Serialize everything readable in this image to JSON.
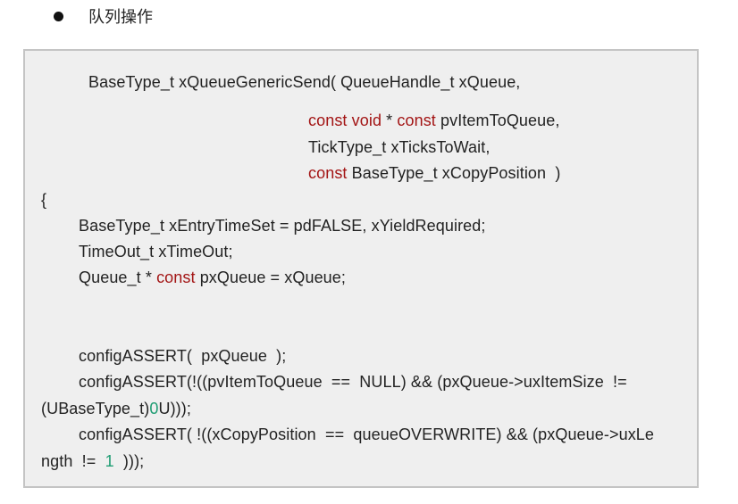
{
  "heading": {
    "text": "队列操作"
  },
  "code": {
    "colors": {
      "keyword": "#a31515",
      "number": "#1f9d73",
      "text": "#222222"
    },
    "l1": {
      "a": "BaseType_t xQueueGenericSend( QueueHandle_t xQueue,"
    },
    "l2": {
      "k1": "const",
      "k2": "void",
      "t1": " * ",
      "k3": "const",
      "t2": " pvItemToQueue,"
    },
    "l3": {
      "a": "TickType_t xTicksToWait,"
    },
    "l4": {
      "k1": "const",
      "t1": " BaseType_t xCopyPosition  )"
    },
    "l5": {
      "a": "{"
    },
    "l6": {
      "a": "BaseType_t xEntryTimeSet = pdFALSE, xYieldRequired;"
    },
    "l7": {
      "a": "TimeOut_t xTimeOut;"
    },
    "l8": {
      "t1": "Queue_t * ",
      "k1": "const",
      "t2": " pxQueue = xQueue;"
    },
    "l9": {
      "a": "configASSERT(  pxQueue  );"
    },
    "l10": {
      "a": "configASSERT(!((pvItemToQueue  ==  NULL) && (pxQueue->uxItemSize  !="
    },
    "l11": {
      "t1": "(UBaseType_t)",
      "n1": "0",
      "t2": "U)));"
    },
    "l12": {
      "a": "configASSERT( !((xCopyPosition  ==  queueOVERWRITE) && (pxQueue->uxLe"
    },
    "l13": {
      "t1": "ngth  !=  ",
      "n1": "1",
      "t2": "  )));"
    }
  }
}
